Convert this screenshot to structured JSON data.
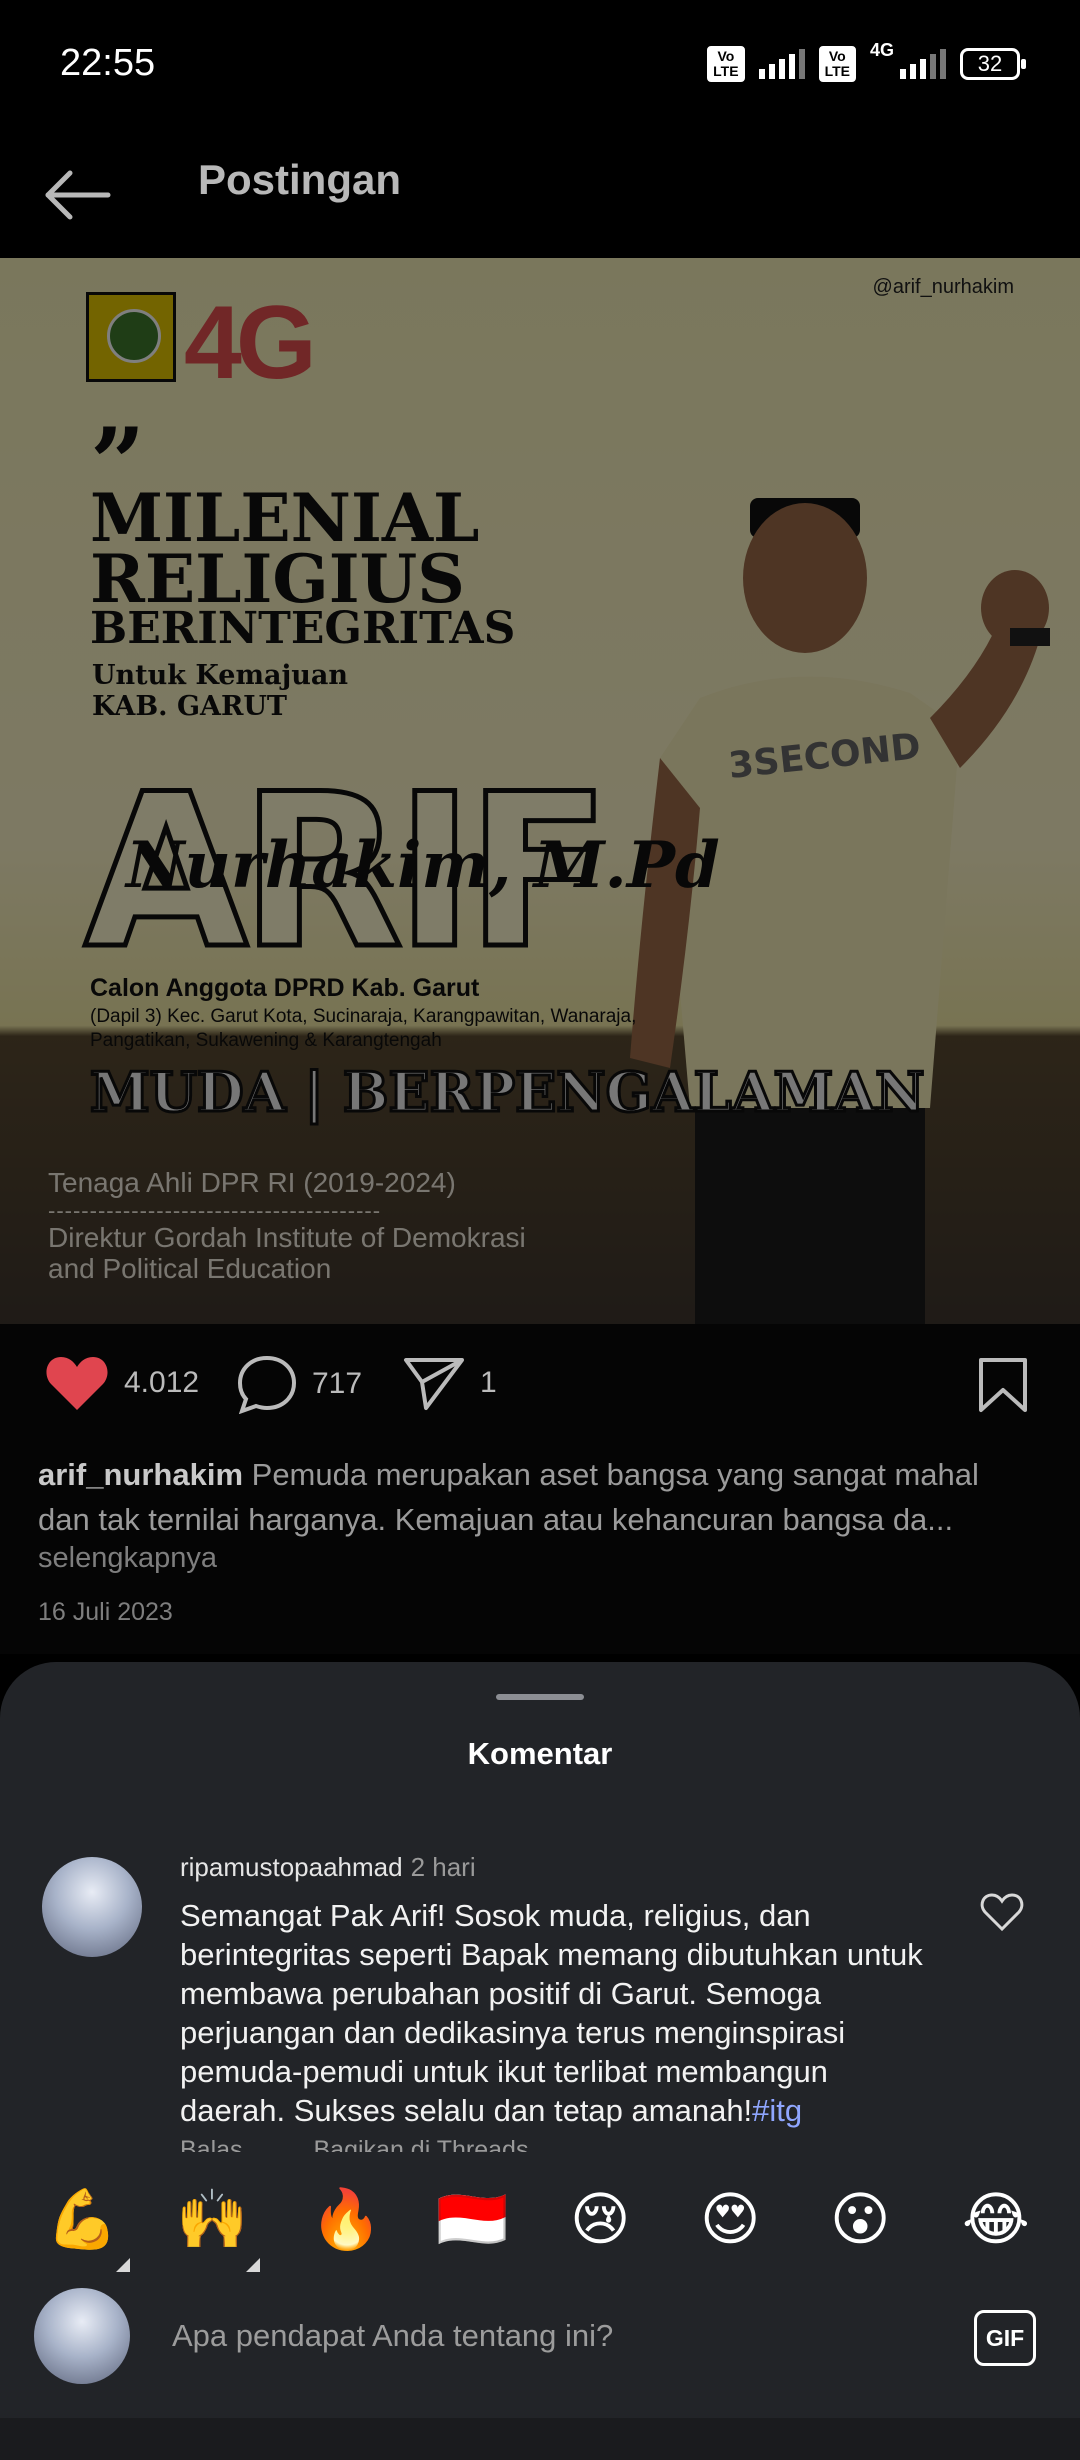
{
  "status": {
    "time": "22:55",
    "volte1": "Vo LTE",
    "volte2": "Vo LTE",
    "network": "4G",
    "battery": "32"
  },
  "header": {
    "title": "Postingan"
  },
  "post_image": {
    "handle": "@arif_nurhakim",
    "quote_mark": "”",
    "line1": "MILENIAL",
    "line2": "RELIGIUS",
    "line3": "BERINTEGRITAS",
    "sub1": "Untuk Kemajuan",
    "sub2": "KAB. GARUT",
    "big_name": "ARIF",
    "script_name": "Nurhakim, M.Pd",
    "calon": "Calon Anggota DPRD Kab. Garut",
    "dapil": "(Dapil 3) Kec. Garut Kota, Sucinaraja, Karangpawitan, Wanaraja, Pangatikan, Sukawening & Karangtengah",
    "tagline": "MUDA | BERPENGALAMAN",
    "role1": "Tenaga Ahli DPR RI (2019-2024)",
    "separator": "----------------------------------------",
    "role2": "Direktur Gordah Institute of Demokrasi",
    "role3": "and Political Education",
    "logo_number": "4G",
    "tshirt_text": "3SECOND"
  },
  "actions": {
    "likes": "4.012",
    "comments": "717",
    "shares": "1"
  },
  "caption": {
    "username": "arif_nurhakim",
    "text": "Pemuda merupakan aset bangsa yang sangat mahal dan tak ternilai harganya. Kemajuan atau kehancuran bangsa da...",
    "more": "selengkapnya",
    "date": "16 Juli 2023"
  },
  "comments_sheet": {
    "title": "Komentar",
    "comment": {
      "username": "ripamustopaahmad",
      "time": "2 hari",
      "text": "Semangat Pak Arif! Sosok muda, religius, dan berintegritas seperti Bapak memang dibutuhkan untuk membawa perubahan positif di Garut. Semoga perjuangan dan dedikasinya terus menginspirasi pemuda-pemudi untuk ikut terlibat membangun daerah. Sukses selalu dan tetap amanah!",
      "hashtag": "#itg",
      "reply": "Balas",
      "share": "Bagikan di Threads"
    },
    "emojis": [
      "💪",
      "🙌",
      "🔥",
      "🇮🇩",
      "😢",
      "😍",
      "😮",
      "😂"
    ],
    "input_placeholder": "Apa pendapat Anda tentang ini?",
    "gif_label": "GIF"
  },
  "colors": {
    "like_red": "#e0454f",
    "hashtag_blue": "#8fa6ff",
    "sheet_bg": "#222428"
  }
}
